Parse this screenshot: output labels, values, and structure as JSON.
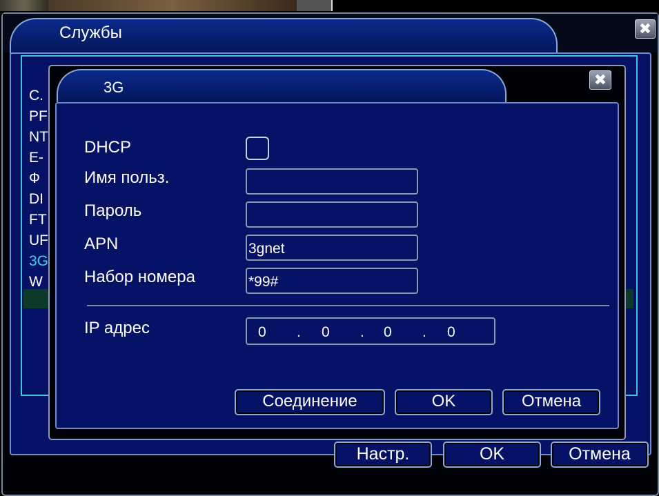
{
  "outer": {
    "title": "Службы",
    "close": "✖",
    "list_items": [
      "С.",
      "PF",
      "NT",
      "E-",
      "Ф",
      "DI",
      "FT",
      "UF",
      "3G",
      "W"
    ],
    "buttons": {
      "setup": "Настр.",
      "ok": "OK",
      "cancel": "Отмена"
    }
  },
  "dialog": {
    "title": "3G",
    "close": "✖",
    "fields": {
      "dhcp_label": "DHCP",
      "username_label": "Имя польз.",
      "username_value": "",
      "password_label": "Пароль",
      "password_value": "",
      "apn_label": "APN",
      "apn_value": "3gnet",
      "dial_label": "Набор номера",
      "dial_value": "*99#",
      "ip_label": "IP адрес",
      "ip": [
        "0",
        "0",
        "0",
        "0"
      ],
      "ip_dot": "."
    },
    "dhcp_checked": false,
    "buttons": {
      "connect": "Соединение",
      "ok": "OK",
      "cancel": "Отмена"
    }
  },
  "colors": {
    "panel_blue": "#061266",
    "selection_cyan": "#3ed4ea",
    "frame_cyan": "#3ec4dc"
  }
}
